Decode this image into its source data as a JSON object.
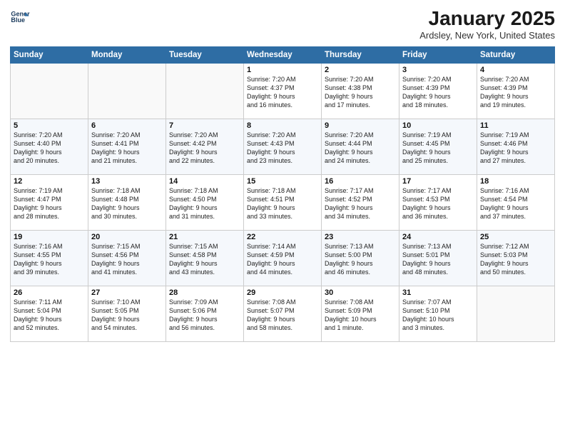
{
  "header": {
    "logo_line1": "General",
    "logo_line2": "Blue",
    "month": "January 2025",
    "location": "Ardsley, New York, United States"
  },
  "days_of_week": [
    "Sunday",
    "Monday",
    "Tuesday",
    "Wednesday",
    "Thursday",
    "Friday",
    "Saturday"
  ],
  "weeks": [
    [
      {
        "day": "",
        "info": ""
      },
      {
        "day": "",
        "info": ""
      },
      {
        "day": "",
        "info": ""
      },
      {
        "day": "1",
        "info": "Sunrise: 7:20 AM\nSunset: 4:37 PM\nDaylight: 9 hours\nand 16 minutes."
      },
      {
        "day": "2",
        "info": "Sunrise: 7:20 AM\nSunset: 4:38 PM\nDaylight: 9 hours\nand 17 minutes."
      },
      {
        "day": "3",
        "info": "Sunrise: 7:20 AM\nSunset: 4:39 PM\nDaylight: 9 hours\nand 18 minutes."
      },
      {
        "day": "4",
        "info": "Sunrise: 7:20 AM\nSunset: 4:39 PM\nDaylight: 9 hours\nand 19 minutes."
      }
    ],
    [
      {
        "day": "5",
        "info": "Sunrise: 7:20 AM\nSunset: 4:40 PM\nDaylight: 9 hours\nand 20 minutes."
      },
      {
        "day": "6",
        "info": "Sunrise: 7:20 AM\nSunset: 4:41 PM\nDaylight: 9 hours\nand 21 minutes."
      },
      {
        "day": "7",
        "info": "Sunrise: 7:20 AM\nSunset: 4:42 PM\nDaylight: 9 hours\nand 22 minutes."
      },
      {
        "day": "8",
        "info": "Sunrise: 7:20 AM\nSunset: 4:43 PM\nDaylight: 9 hours\nand 23 minutes."
      },
      {
        "day": "9",
        "info": "Sunrise: 7:20 AM\nSunset: 4:44 PM\nDaylight: 9 hours\nand 24 minutes."
      },
      {
        "day": "10",
        "info": "Sunrise: 7:19 AM\nSunset: 4:45 PM\nDaylight: 9 hours\nand 25 minutes."
      },
      {
        "day": "11",
        "info": "Sunrise: 7:19 AM\nSunset: 4:46 PM\nDaylight: 9 hours\nand 27 minutes."
      }
    ],
    [
      {
        "day": "12",
        "info": "Sunrise: 7:19 AM\nSunset: 4:47 PM\nDaylight: 9 hours\nand 28 minutes."
      },
      {
        "day": "13",
        "info": "Sunrise: 7:18 AM\nSunset: 4:48 PM\nDaylight: 9 hours\nand 30 minutes."
      },
      {
        "day": "14",
        "info": "Sunrise: 7:18 AM\nSunset: 4:50 PM\nDaylight: 9 hours\nand 31 minutes."
      },
      {
        "day": "15",
        "info": "Sunrise: 7:18 AM\nSunset: 4:51 PM\nDaylight: 9 hours\nand 33 minutes."
      },
      {
        "day": "16",
        "info": "Sunrise: 7:17 AM\nSunset: 4:52 PM\nDaylight: 9 hours\nand 34 minutes."
      },
      {
        "day": "17",
        "info": "Sunrise: 7:17 AM\nSunset: 4:53 PM\nDaylight: 9 hours\nand 36 minutes."
      },
      {
        "day": "18",
        "info": "Sunrise: 7:16 AM\nSunset: 4:54 PM\nDaylight: 9 hours\nand 37 minutes."
      }
    ],
    [
      {
        "day": "19",
        "info": "Sunrise: 7:16 AM\nSunset: 4:55 PM\nDaylight: 9 hours\nand 39 minutes."
      },
      {
        "day": "20",
        "info": "Sunrise: 7:15 AM\nSunset: 4:56 PM\nDaylight: 9 hours\nand 41 minutes."
      },
      {
        "day": "21",
        "info": "Sunrise: 7:15 AM\nSunset: 4:58 PM\nDaylight: 9 hours\nand 43 minutes."
      },
      {
        "day": "22",
        "info": "Sunrise: 7:14 AM\nSunset: 4:59 PM\nDaylight: 9 hours\nand 44 minutes."
      },
      {
        "day": "23",
        "info": "Sunrise: 7:13 AM\nSunset: 5:00 PM\nDaylight: 9 hours\nand 46 minutes."
      },
      {
        "day": "24",
        "info": "Sunrise: 7:13 AM\nSunset: 5:01 PM\nDaylight: 9 hours\nand 48 minutes."
      },
      {
        "day": "25",
        "info": "Sunrise: 7:12 AM\nSunset: 5:03 PM\nDaylight: 9 hours\nand 50 minutes."
      }
    ],
    [
      {
        "day": "26",
        "info": "Sunrise: 7:11 AM\nSunset: 5:04 PM\nDaylight: 9 hours\nand 52 minutes."
      },
      {
        "day": "27",
        "info": "Sunrise: 7:10 AM\nSunset: 5:05 PM\nDaylight: 9 hours\nand 54 minutes."
      },
      {
        "day": "28",
        "info": "Sunrise: 7:09 AM\nSunset: 5:06 PM\nDaylight: 9 hours\nand 56 minutes."
      },
      {
        "day": "29",
        "info": "Sunrise: 7:08 AM\nSunset: 5:07 PM\nDaylight: 9 hours\nand 58 minutes."
      },
      {
        "day": "30",
        "info": "Sunrise: 7:08 AM\nSunset: 5:09 PM\nDaylight: 10 hours\nand 1 minute."
      },
      {
        "day": "31",
        "info": "Sunrise: 7:07 AM\nSunset: 5:10 PM\nDaylight: 10 hours\nand 3 minutes."
      },
      {
        "day": "",
        "info": ""
      }
    ]
  ]
}
